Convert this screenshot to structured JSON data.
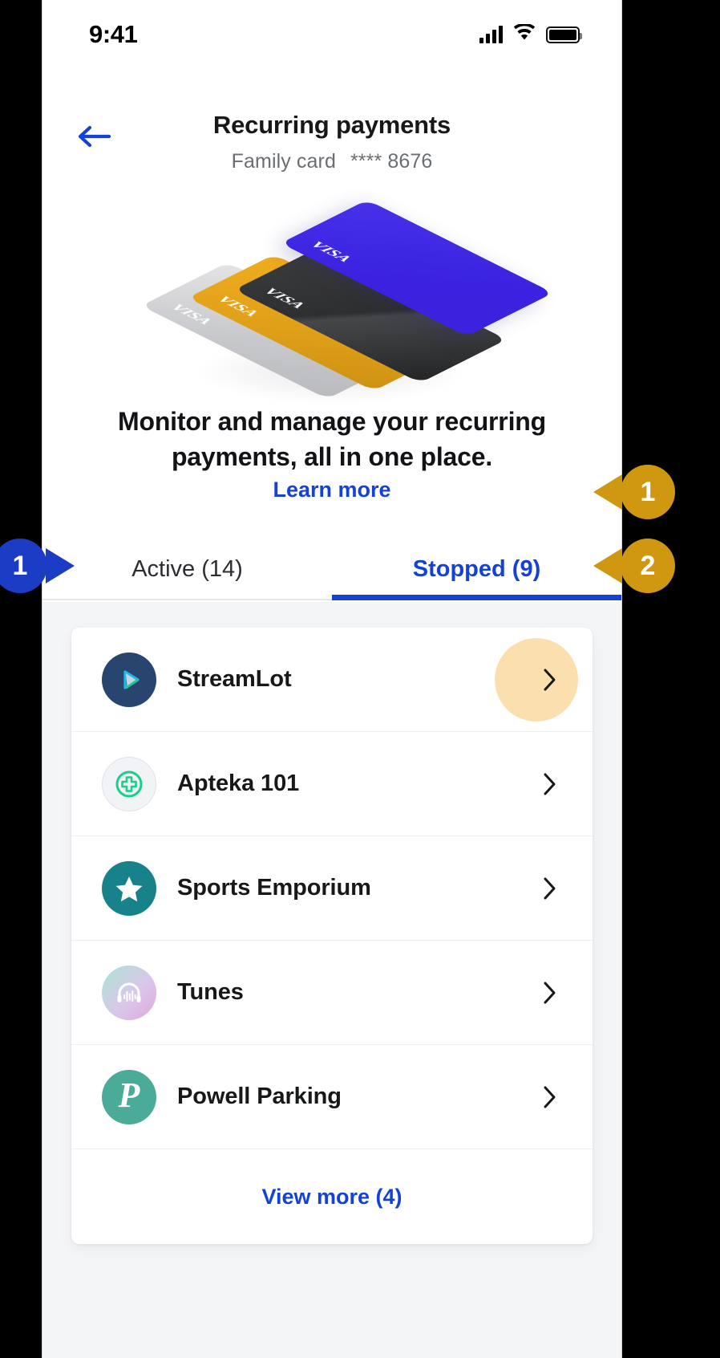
{
  "status_bar": {
    "time": "9:41",
    "signal_icon": "cellular-signal-icon",
    "wifi_icon": "wifi-icon",
    "battery_icon": "battery-full-icon"
  },
  "header": {
    "back_icon": "back-arrow-icon",
    "title": "Recurring payments",
    "card_name": "Family card",
    "card_mask": "**** 8676"
  },
  "hero": {
    "illustration": "stacked-visa-cards-illustration",
    "cards": [
      {
        "brand": "VISA",
        "color": "#c9cacd",
        "name": "silver-visa-card"
      },
      {
        "brand": "VISA",
        "color": "#e0a019",
        "name": "gold-visa-card"
      },
      {
        "brand": "VISA",
        "color": "#2e2f30",
        "name": "black-visa-card"
      },
      {
        "brand": "VISA",
        "color": "#3a22e0",
        "name": "blue-visa-card"
      }
    ],
    "headline": "Monitor and manage your recurring payments, all in one place.",
    "learn_more": "Learn more"
  },
  "tabs": [
    {
      "label": "Active (14)",
      "active": false,
      "count": 14
    },
    {
      "label": "Stopped (9)",
      "active": true,
      "count": 9
    }
  ],
  "list": {
    "rows": [
      {
        "name": "StreamLot",
        "icon": "streamlot-play-icon",
        "chevron": "chevron-right-icon",
        "highlighted": true
      },
      {
        "name": "Apteka 101",
        "icon": "pharmacy-cross-icon",
        "chevron": "chevron-right-icon",
        "highlighted": false
      },
      {
        "name": "Sports Emporium",
        "icon": "star-icon",
        "chevron": "chevron-right-icon",
        "highlighted": false
      },
      {
        "name": "Tunes",
        "icon": "headphones-icon",
        "chevron": "chevron-right-icon",
        "highlighted": false
      },
      {
        "name": "Powell Parking",
        "icon": "letter-p-icon",
        "chevron": "chevron-right-icon",
        "highlighted": false
      }
    ],
    "view_more": "View more (4)"
  },
  "annotations": [
    {
      "id": "blue-1",
      "label": "1",
      "color": "#1b3cc4",
      "direction": "right"
    },
    {
      "id": "gold-1",
      "label": "1",
      "color": "#cf9810",
      "direction": "left"
    },
    {
      "id": "gold-2",
      "label": "2",
      "color": "#cf9810",
      "direction": "left"
    }
  ],
  "colors": {
    "accent_blue": "#1542d6",
    "marker_blue": "#1b3cc4",
    "marker_gold": "#cf9810",
    "highlight_circle": "#fbdfae",
    "panel_bg": "#f4f5f7"
  }
}
